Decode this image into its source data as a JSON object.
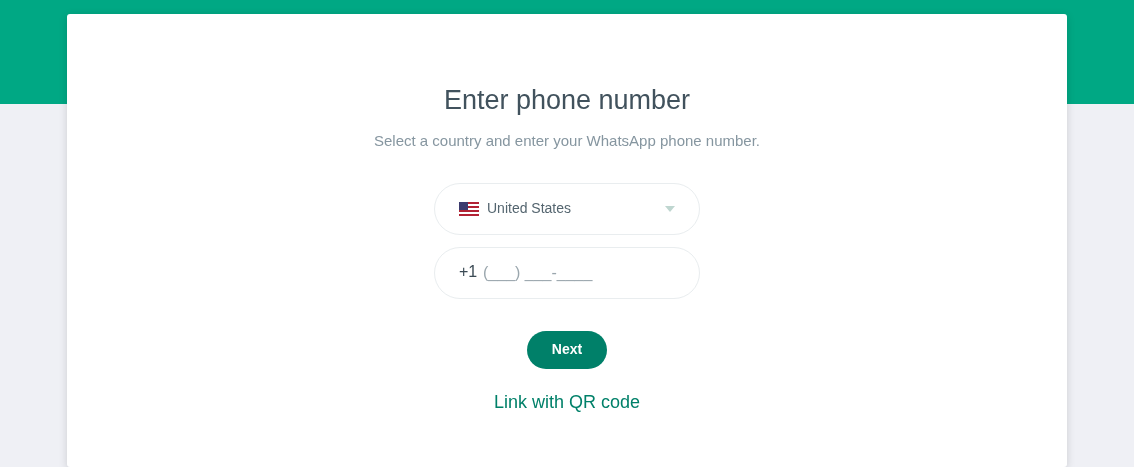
{
  "title": "Enter phone number",
  "subtitle": "Select a country and enter your WhatsApp phone number.",
  "country_select": {
    "value": "United States"
  },
  "phone_field": {
    "prefix": "+1",
    "placeholder": "(___) ___-____"
  },
  "next_button": "Next",
  "qr_link": "Link with QR code"
}
